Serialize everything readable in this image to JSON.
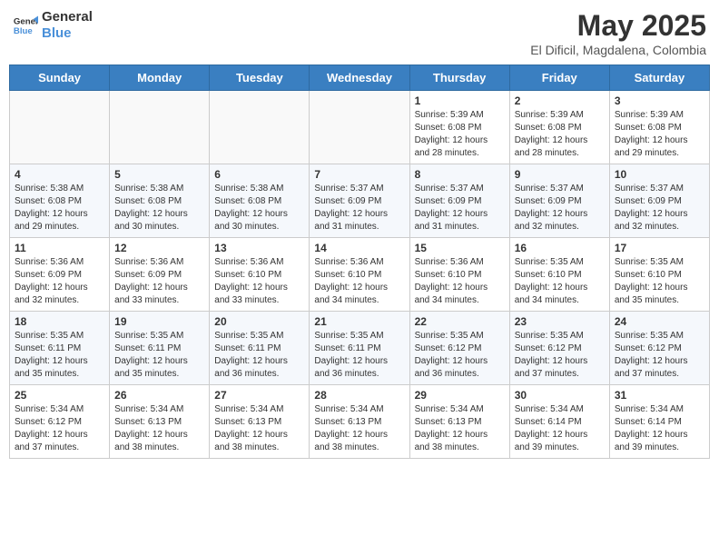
{
  "logo": {
    "line1": "General",
    "line2": "Blue"
  },
  "title": "May 2025",
  "subtitle": "El Dificil, Magdalena, Colombia",
  "weekdays": [
    "Sunday",
    "Monday",
    "Tuesday",
    "Wednesday",
    "Thursday",
    "Friday",
    "Saturday"
  ],
  "weeks": [
    [
      {
        "day": "",
        "info": ""
      },
      {
        "day": "",
        "info": ""
      },
      {
        "day": "",
        "info": ""
      },
      {
        "day": "",
        "info": ""
      },
      {
        "day": "1",
        "info": "Sunrise: 5:39 AM\nSunset: 6:08 PM\nDaylight: 12 hours and 28 minutes."
      },
      {
        "day": "2",
        "info": "Sunrise: 5:39 AM\nSunset: 6:08 PM\nDaylight: 12 hours and 28 minutes."
      },
      {
        "day": "3",
        "info": "Sunrise: 5:39 AM\nSunset: 6:08 PM\nDaylight: 12 hours and 29 minutes."
      }
    ],
    [
      {
        "day": "4",
        "info": "Sunrise: 5:38 AM\nSunset: 6:08 PM\nDaylight: 12 hours and 29 minutes."
      },
      {
        "day": "5",
        "info": "Sunrise: 5:38 AM\nSunset: 6:08 PM\nDaylight: 12 hours and 30 minutes."
      },
      {
        "day": "6",
        "info": "Sunrise: 5:38 AM\nSunset: 6:08 PM\nDaylight: 12 hours and 30 minutes."
      },
      {
        "day": "7",
        "info": "Sunrise: 5:37 AM\nSunset: 6:09 PM\nDaylight: 12 hours and 31 minutes."
      },
      {
        "day": "8",
        "info": "Sunrise: 5:37 AM\nSunset: 6:09 PM\nDaylight: 12 hours and 31 minutes."
      },
      {
        "day": "9",
        "info": "Sunrise: 5:37 AM\nSunset: 6:09 PM\nDaylight: 12 hours and 32 minutes."
      },
      {
        "day": "10",
        "info": "Sunrise: 5:37 AM\nSunset: 6:09 PM\nDaylight: 12 hours and 32 minutes."
      }
    ],
    [
      {
        "day": "11",
        "info": "Sunrise: 5:36 AM\nSunset: 6:09 PM\nDaylight: 12 hours and 32 minutes."
      },
      {
        "day": "12",
        "info": "Sunrise: 5:36 AM\nSunset: 6:09 PM\nDaylight: 12 hours and 33 minutes."
      },
      {
        "day": "13",
        "info": "Sunrise: 5:36 AM\nSunset: 6:10 PM\nDaylight: 12 hours and 33 minutes."
      },
      {
        "day": "14",
        "info": "Sunrise: 5:36 AM\nSunset: 6:10 PM\nDaylight: 12 hours and 34 minutes."
      },
      {
        "day": "15",
        "info": "Sunrise: 5:36 AM\nSunset: 6:10 PM\nDaylight: 12 hours and 34 minutes."
      },
      {
        "day": "16",
        "info": "Sunrise: 5:35 AM\nSunset: 6:10 PM\nDaylight: 12 hours and 34 minutes."
      },
      {
        "day": "17",
        "info": "Sunrise: 5:35 AM\nSunset: 6:10 PM\nDaylight: 12 hours and 35 minutes."
      }
    ],
    [
      {
        "day": "18",
        "info": "Sunrise: 5:35 AM\nSunset: 6:11 PM\nDaylight: 12 hours and 35 minutes."
      },
      {
        "day": "19",
        "info": "Sunrise: 5:35 AM\nSunset: 6:11 PM\nDaylight: 12 hours and 35 minutes."
      },
      {
        "day": "20",
        "info": "Sunrise: 5:35 AM\nSunset: 6:11 PM\nDaylight: 12 hours and 36 minutes."
      },
      {
        "day": "21",
        "info": "Sunrise: 5:35 AM\nSunset: 6:11 PM\nDaylight: 12 hours and 36 minutes."
      },
      {
        "day": "22",
        "info": "Sunrise: 5:35 AM\nSunset: 6:12 PM\nDaylight: 12 hours and 36 minutes."
      },
      {
        "day": "23",
        "info": "Sunrise: 5:35 AM\nSunset: 6:12 PM\nDaylight: 12 hours and 37 minutes."
      },
      {
        "day": "24",
        "info": "Sunrise: 5:35 AM\nSunset: 6:12 PM\nDaylight: 12 hours and 37 minutes."
      }
    ],
    [
      {
        "day": "25",
        "info": "Sunrise: 5:34 AM\nSunset: 6:12 PM\nDaylight: 12 hours and 37 minutes."
      },
      {
        "day": "26",
        "info": "Sunrise: 5:34 AM\nSunset: 6:13 PM\nDaylight: 12 hours and 38 minutes."
      },
      {
        "day": "27",
        "info": "Sunrise: 5:34 AM\nSunset: 6:13 PM\nDaylight: 12 hours and 38 minutes."
      },
      {
        "day": "28",
        "info": "Sunrise: 5:34 AM\nSunset: 6:13 PM\nDaylight: 12 hours and 38 minutes."
      },
      {
        "day": "29",
        "info": "Sunrise: 5:34 AM\nSunset: 6:13 PM\nDaylight: 12 hours and 38 minutes."
      },
      {
        "day": "30",
        "info": "Sunrise: 5:34 AM\nSunset: 6:14 PM\nDaylight: 12 hours and 39 minutes."
      },
      {
        "day": "31",
        "info": "Sunrise: 5:34 AM\nSunset: 6:14 PM\nDaylight: 12 hours and 39 minutes."
      }
    ]
  ]
}
